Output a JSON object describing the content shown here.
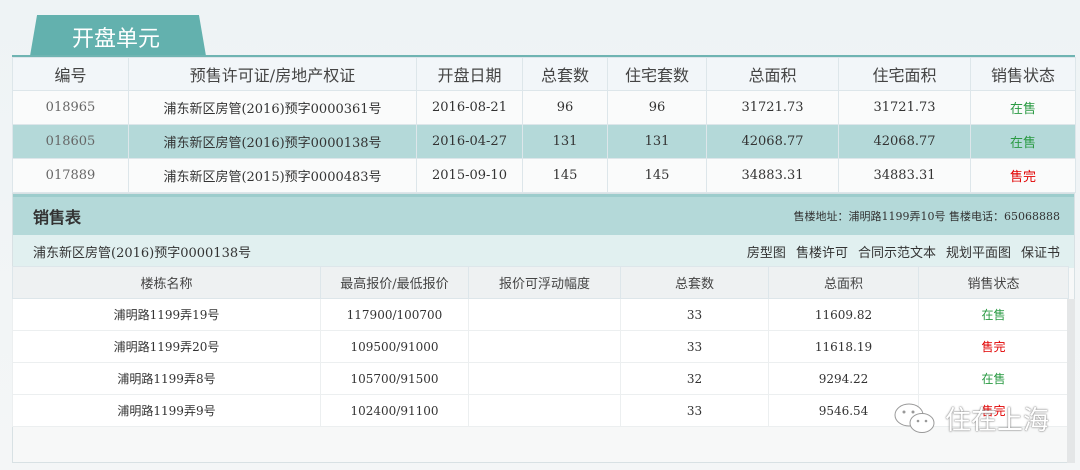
{
  "tab_title": "开盘单元",
  "units": {
    "headers": [
      "编号",
      "预售许可证/房地产权证",
      "开盘日期",
      "总套数",
      "住宅套数",
      "总面积",
      "住宅面积",
      "销售状态"
    ],
    "rows": [
      [
        "018965",
        "浦东新区房管(2016)预字0000361号",
        "2016-08-21",
        "96",
        "96",
        "31721.73",
        "31721.73",
        "在售"
      ],
      [
        "018605",
        "浦东新区房管(2016)预字0000138号",
        "2016-04-27",
        "131",
        "131",
        "42068.77",
        "42068.77",
        "在售"
      ],
      [
        "017889",
        "浦东新区房管(2015)预字0000483号",
        "2015-09-10",
        "145",
        "145",
        "34883.31",
        "34883.31",
        "售完"
      ]
    ]
  },
  "sales": {
    "title": "销售表",
    "info": "售楼地址：浦明路1199弄10号 售楼电话：65068888",
    "permit": "浦东新区房管(2016)预字0000138号",
    "links": [
      "房型图",
      "售楼许可",
      "合同示范文本",
      "规划平面图",
      "保证书"
    ],
    "headers": [
      "楼栋名称",
      "最高报价/最低报价",
      "报价可浮动幅度",
      "总套数",
      "总面积",
      "销售状态"
    ],
    "rows": [
      [
        "浦明路1199弄19号",
        "117900/100700",
        "",
        "33",
        "11609.82",
        "在售"
      ],
      [
        "浦明路1199弄20号",
        "109500/91000",
        "",
        "33",
        "11618.19",
        "售完"
      ],
      [
        "浦明路1199弄8号",
        "105700/91500",
        "",
        "32",
        "9294.22",
        "在售"
      ],
      [
        "浦明路1199弄9号",
        "102400/91100",
        "",
        "33",
        "9546.54",
        "售完"
      ]
    ]
  },
  "watermark": "住在上海"
}
